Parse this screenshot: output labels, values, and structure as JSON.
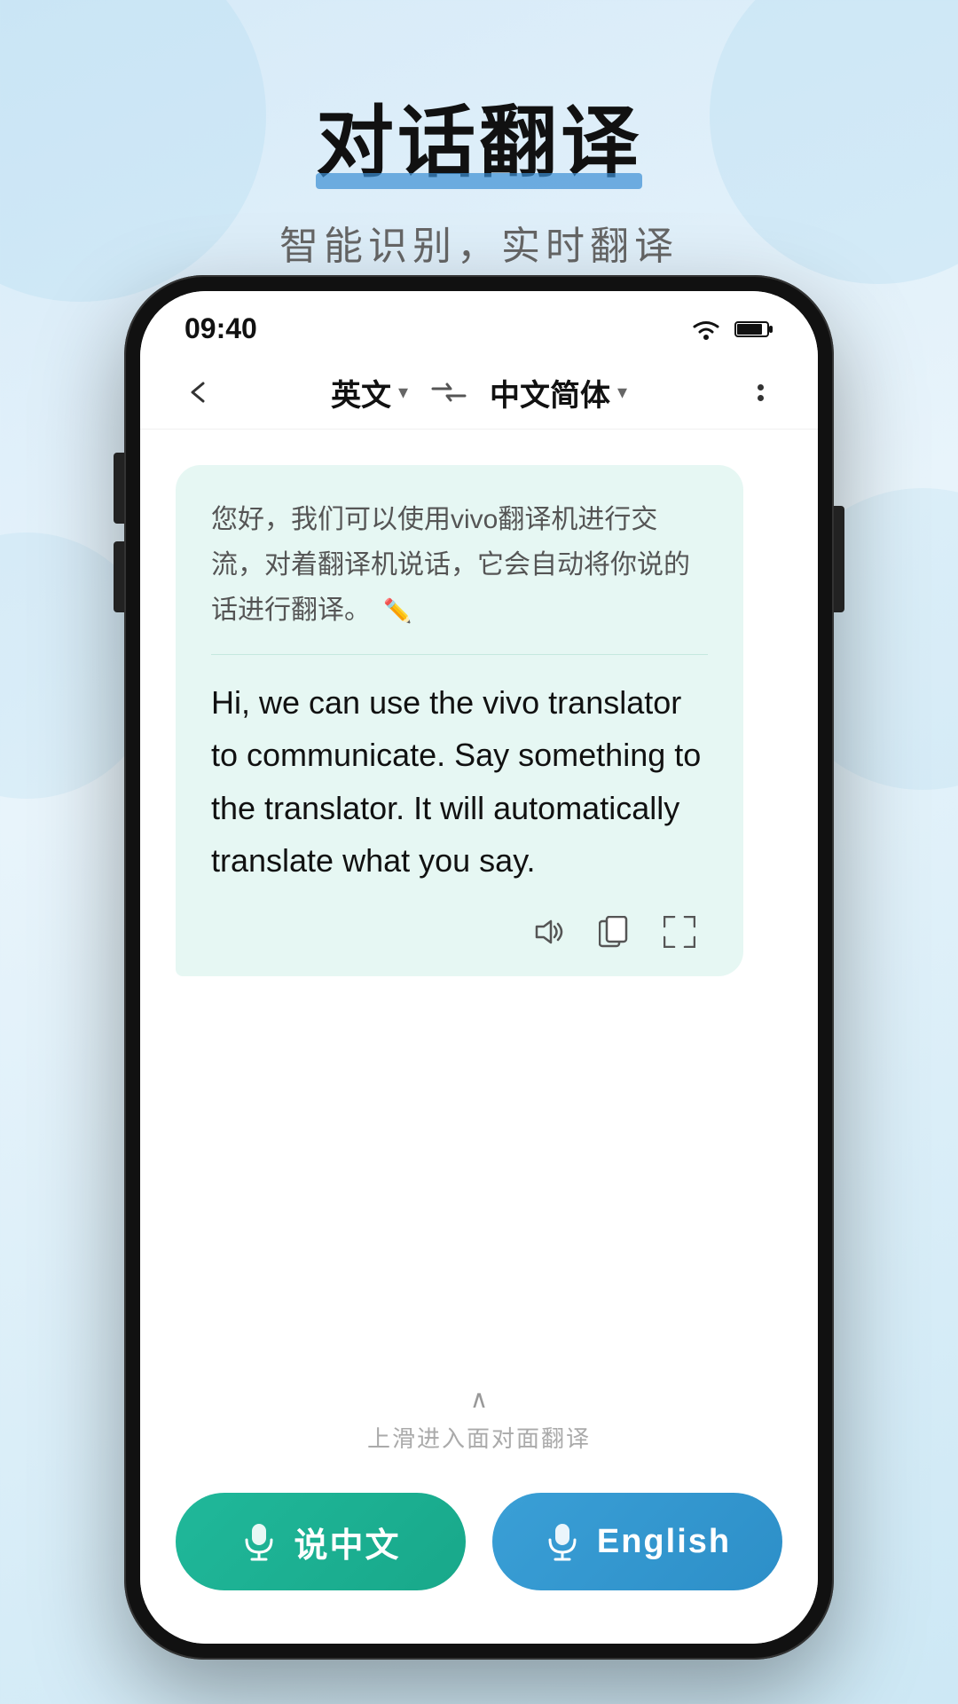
{
  "page": {
    "main_title": "对话翻译",
    "subtitle": "智能识别，实时翻译",
    "bg_circles": [
      1,
      2,
      3,
      4
    ]
  },
  "status_bar": {
    "time": "09:40"
  },
  "header": {
    "source_lang": "英文",
    "source_lang_chevron": "▾",
    "target_lang": "中文简体",
    "target_lang_chevron": "▾"
  },
  "message": {
    "chinese": "您好，我们可以使用vivo翻译机进行交流，对着翻译机说话，它会自动将你说的话进行翻译。",
    "english": "Hi, we can use the vivo translator to communicate. Say something to the translator. It will  automatically translate what you say."
  },
  "bottom": {
    "slide_arrow": "∧",
    "slide_text": "上滑进入面对面翻译",
    "btn_chinese_label": "说中文",
    "btn_english_label": "English"
  }
}
